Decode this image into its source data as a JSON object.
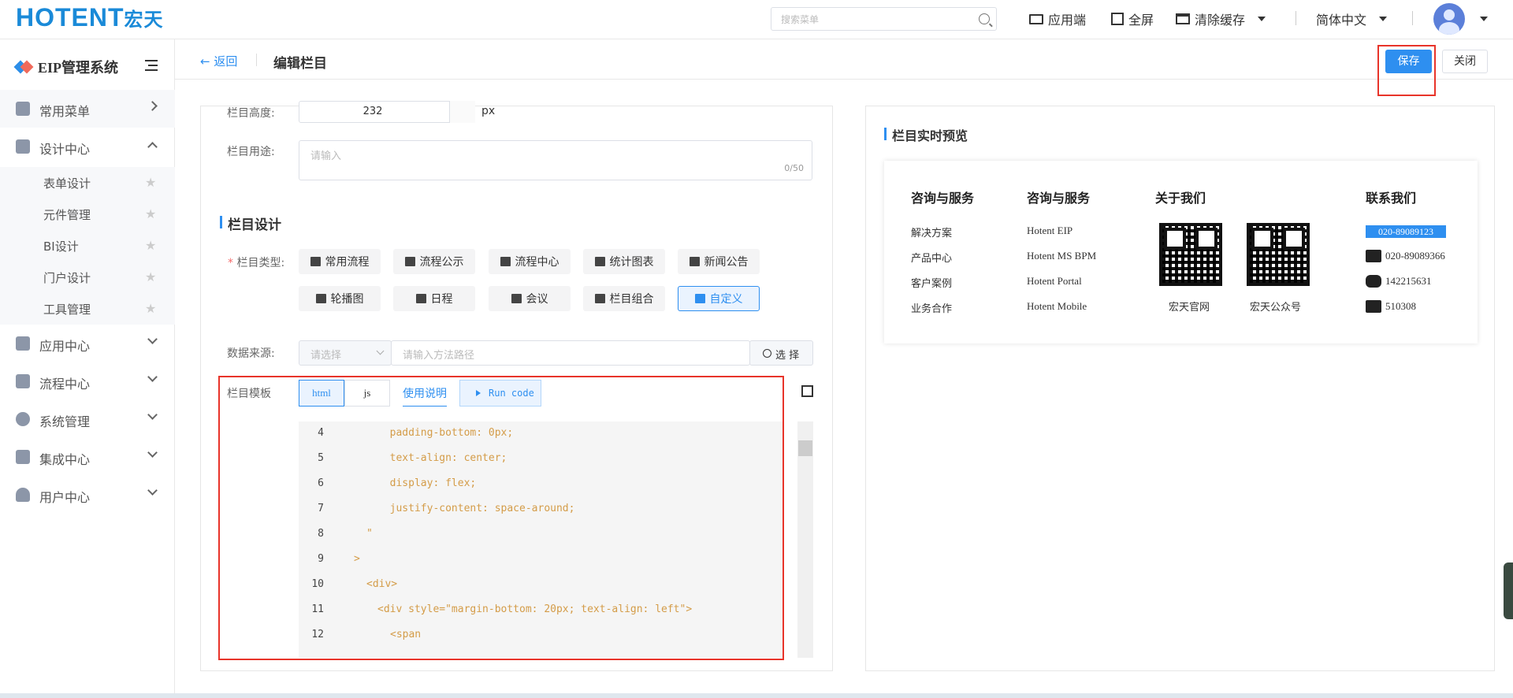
{
  "topbar": {
    "logo_text": "HOTENT",
    "logo_cn": "宏天",
    "search_placeholder": "搜索菜单",
    "app_label": "应用端",
    "fullscreen_label": "全屏",
    "clear_cache_label": "清除缓存",
    "language_label": "简体中文"
  },
  "sidebar": {
    "title": "EIP管理系统",
    "menus": [
      {
        "label": "常用菜单"
      },
      {
        "label": "设计中心"
      },
      {
        "label": "应用中心"
      },
      {
        "label": "流程中心"
      },
      {
        "label": "系统管理"
      },
      {
        "label": "集成中心"
      },
      {
        "label": "用户中心"
      }
    ],
    "design_sub": [
      "表单设计",
      "元件管理",
      "BI设计",
      "门户设计",
      "工具管理"
    ]
  },
  "header": {
    "back_label": "返回",
    "title": "编辑栏目",
    "save_label": "保存",
    "close_label": "关闭"
  },
  "form": {
    "height_label": "栏目高度:",
    "height_value": "232",
    "height_unit": "px",
    "usage_label": "栏目用途:",
    "usage_placeholder": "请输入",
    "usage_count": "0/50",
    "design_title": "栏目设计",
    "type_label": "栏目类型:",
    "types": [
      "常用流程",
      "流程公示",
      "流程中心",
      "统计图表",
      "新闻公告",
      "轮播图",
      "日程",
      "会议",
      "栏目组合",
      "自定义"
    ],
    "datasource_label": "数据来源:",
    "datasource_select": "请选择",
    "datasource_placeholder": "请输入方法路径",
    "select_button": "选 择",
    "template_label": "栏目模板",
    "tab_html": "html",
    "tab_js": "js",
    "usage_doc": "使用说明",
    "run_code": "Run code"
  },
  "code_lines": [
    {
      "n": "4",
      "text": "  padding-bottom: 0px;"
    },
    {
      "n": "5",
      "text": "  text-align: center;"
    },
    {
      "n": "6",
      "text": "  display: flex;"
    },
    {
      "n": "7",
      "text": "  justify-content: space-around;"
    },
    {
      "n": "8",
      "text": "\""
    },
    {
      "n": "9",
      "text": ">"
    },
    {
      "n": "10",
      "text": "<div>"
    },
    {
      "n": "11",
      "text": "<div style=\"margin-bottom: 20px; text-align: left\">"
    },
    {
      "n": "12",
      "text": "<span"
    }
  ],
  "preview": {
    "title": "栏目实时预览",
    "col1_title": "咨询与服务",
    "col1_items": [
      "解决方案",
      "产品中心",
      "客户案例",
      "业务合作"
    ],
    "col2_title": "咨询与服务",
    "col2_items": [
      "Hotent EIP",
      "Hotent MS BPM",
      "Hotent Portal",
      "Hotent Mobile"
    ],
    "col3_title": "关于我们",
    "qr1_label": "宏天官网",
    "qr2_label": "宏天公众号",
    "col4_title": "联系我们",
    "phone1": "020-89089123",
    "phone2": "020-89089366",
    "qq": "142215631",
    "code": "510308"
  }
}
